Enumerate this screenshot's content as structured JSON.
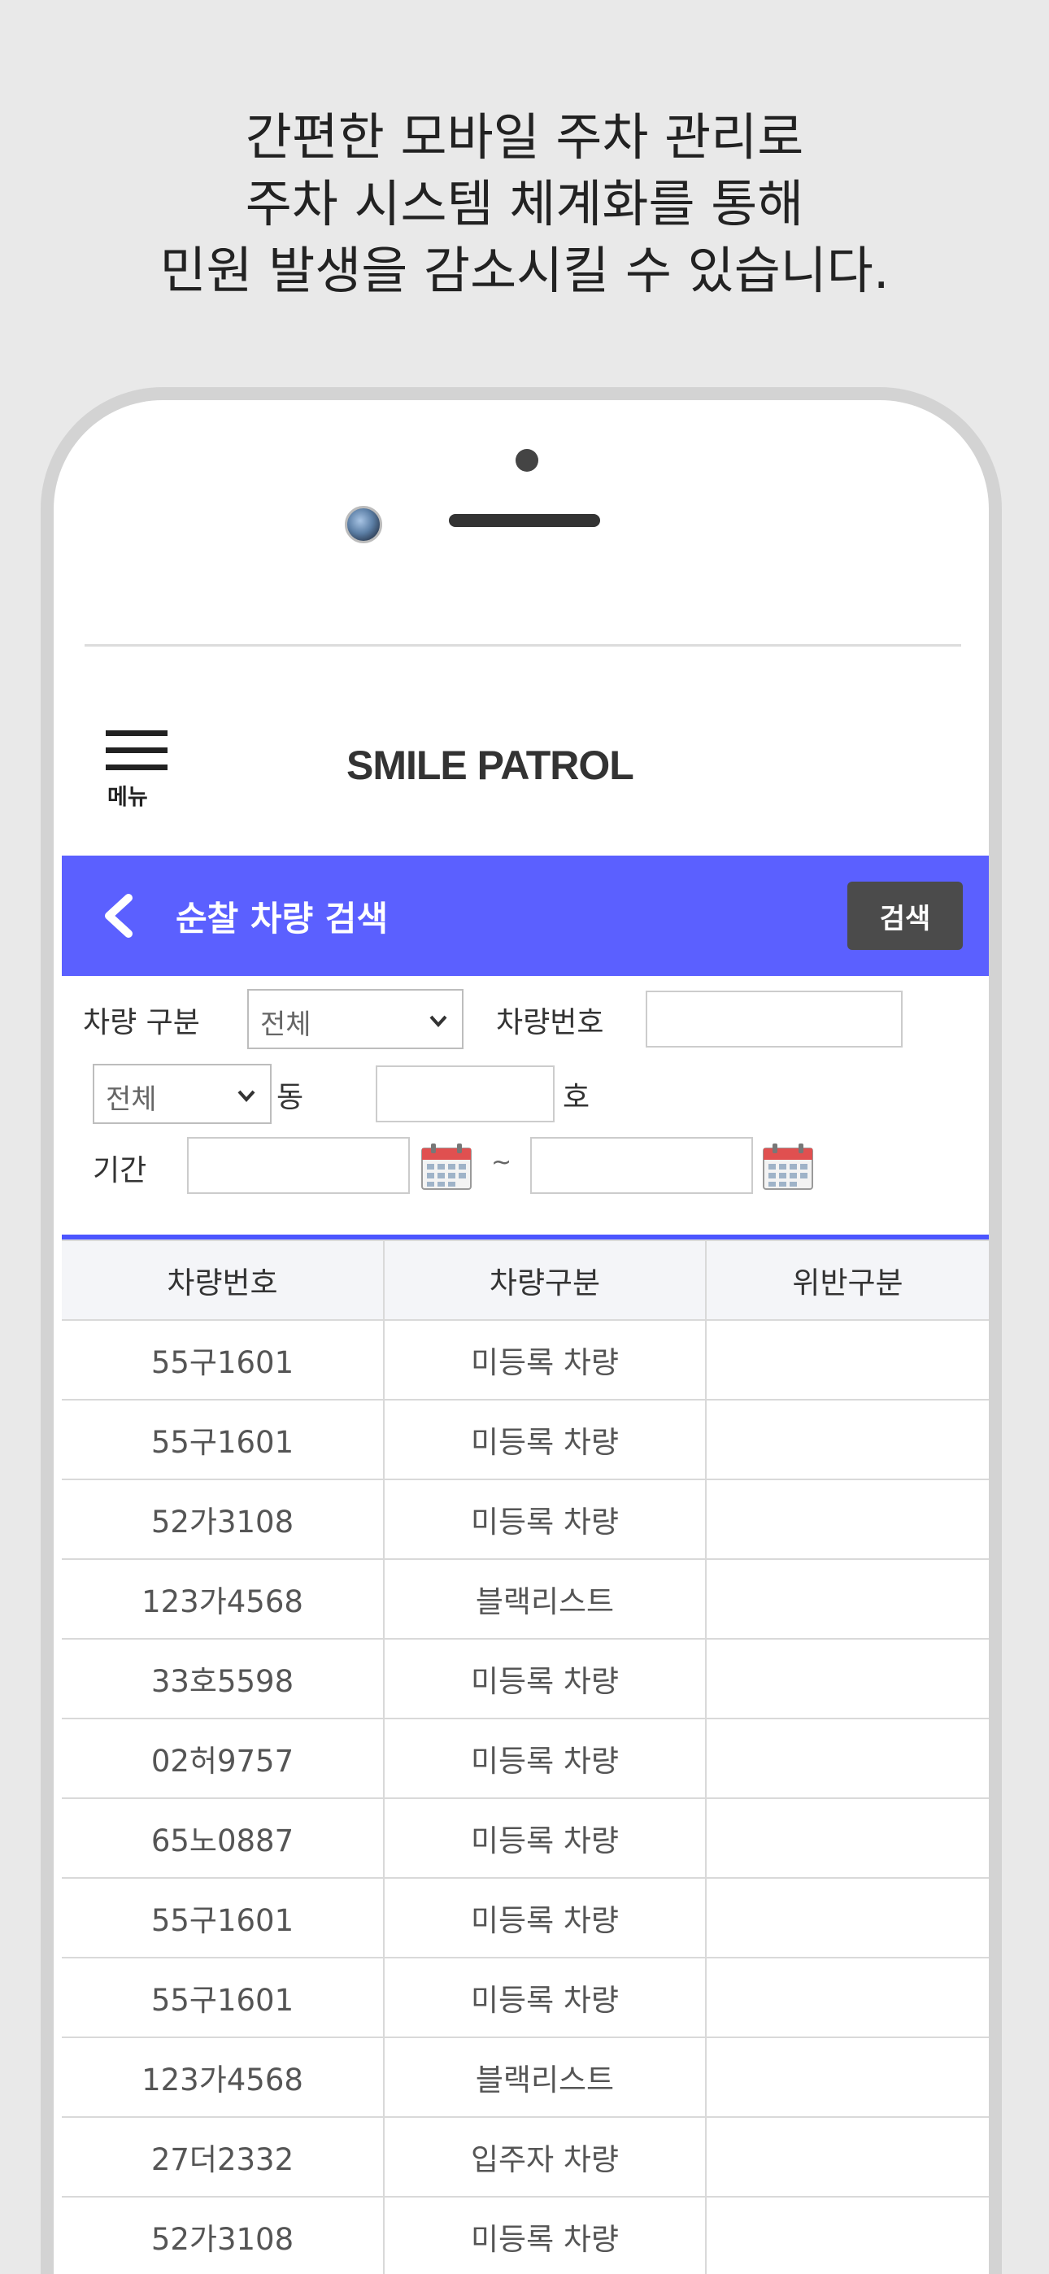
{
  "headline": [
    "간편한 모바일 주차 관리로",
    "주차 시스템 체계화를 통해",
    "민원 발생을 감소시킬 수 있습니다."
  ],
  "header": {
    "menu_label": "메뉴",
    "brand": "SMILE PATROL"
  },
  "title_bar": {
    "title": "순찰 차량 검색",
    "search_button": "검색"
  },
  "filters": {
    "vehicle_type_label": "차량 구분",
    "vehicle_type_value": "전체",
    "plate_label": "차량번호",
    "plate_value": "",
    "dong_select_value": "전체",
    "dong_label": "동",
    "dong_value": "",
    "ho_label": "호",
    "ho_value": "",
    "period_label": "기간",
    "period_start": "",
    "period_separator": "~",
    "period_end": ""
  },
  "table": {
    "headers": [
      "차량번호",
      "차량구분",
      "위반구분"
    ],
    "rows": [
      [
        "55구1601",
        "미등록 차량",
        ""
      ],
      [
        "55구1601",
        "미등록 차량",
        ""
      ],
      [
        "52가3108",
        "미등록 차량",
        ""
      ],
      [
        "123가4568",
        "블랙리스트",
        ""
      ],
      [
        "33호5598",
        "미등록 차량",
        ""
      ],
      [
        "02허9757",
        "미등록 차량",
        ""
      ],
      [
        "65노0887",
        "미등록 차량",
        ""
      ],
      [
        "55구1601",
        "미등록 차량",
        ""
      ],
      [
        "55구1601",
        "미등록 차량",
        ""
      ],
      [
        "123가4568",
        "블랙리스트",
        ""
      ],
      [
        "27더2332",
        "입주자 차량",
        ""
      ],
      [
        "52가3108",
        "미등록 차량",
        ""
      ]
    ]
  },
  "colors": {
    "accent": "#5b60ff",
    "accent_line": "#4b55ff",
    "button_dark": "#4b4b4b",
    "background": "#e9e9e9"
  },
  "icons": {
    "menu": "hamburger-icon",
    "back": "chevron-left-icon",
    "calendar": "calendar-icon",
    "dropdown": "chevron-down-icon"
  }
}
